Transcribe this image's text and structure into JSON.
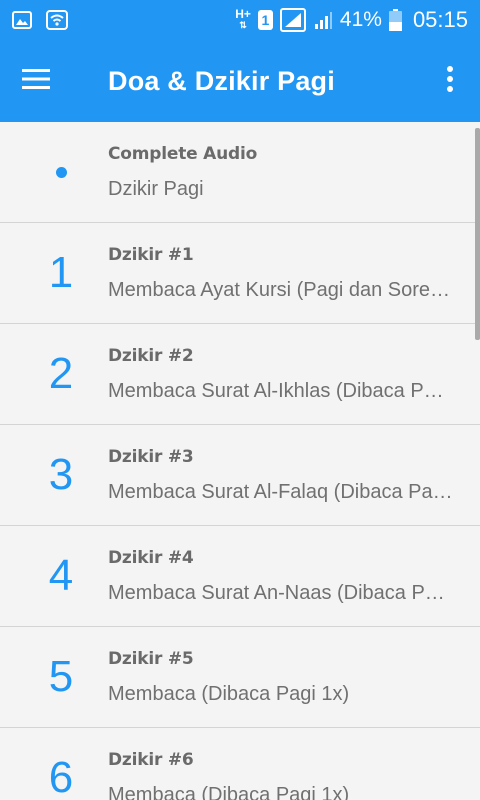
{
  "status_bar": {
    "network_type": "H+",
    "sim_slot": "1",
    "battery_percent": "41%",
    "time": "05:15",
    "icons": [
      "image-icon",
      "wifi-icon",
      "signal-icon",
      "signal-icon",
      "battery-icon"
    ]
  },
  "app_bar": {
    "title": "Doa & Dzikir Pagi",
    "menu_icon": "hamburger-icon",
    "overflow_icon": "more-vert-icon"
  },
  "colors": {
    "primary": "#2196f3",
    "background": "#f4f4f4",
    "divider": "#d4d4d4",
    "text_secondary": "#707070"
  },
  "items": [
    {
      "number": "",
      "marker": "dot",
      "title": "Complete Audio",
      "subtitle": "Dzikir Pagi"
    },
    {
      "number": "1",
      "title": "Dzikir #1",
      "subtitle": "Membaca Ayat Kursi (Pagi dan Sore…"
    },
    {
      "number": "2",
      "title": "Dzikir #2",
      "subtitle": "Membaca Surat Al-Ikhlas (Dibaca P…"
    },
    {
      "number": "3",
      "title": "Dzikir #3",
      "subtitle": "Membaca Surat Al-Falaq (Dibaca Pa…"
    },
    {
      "number": "4",
      "title": "Dzikir #4",
      "subtitle": "Membaca Surat An-Naas (Dibaca P…"
    },
    {
      "number": "5",
      "title": "Dzikir #5",
      "subtitle": "Membaca (Dibaca Pagi 1x)"
    },
    {
      "number": "6",
      "title": "Dzikir #6",
      "subtitle": "Membaca (Dibaca Pagi 1x)"
    }
  ]
}
